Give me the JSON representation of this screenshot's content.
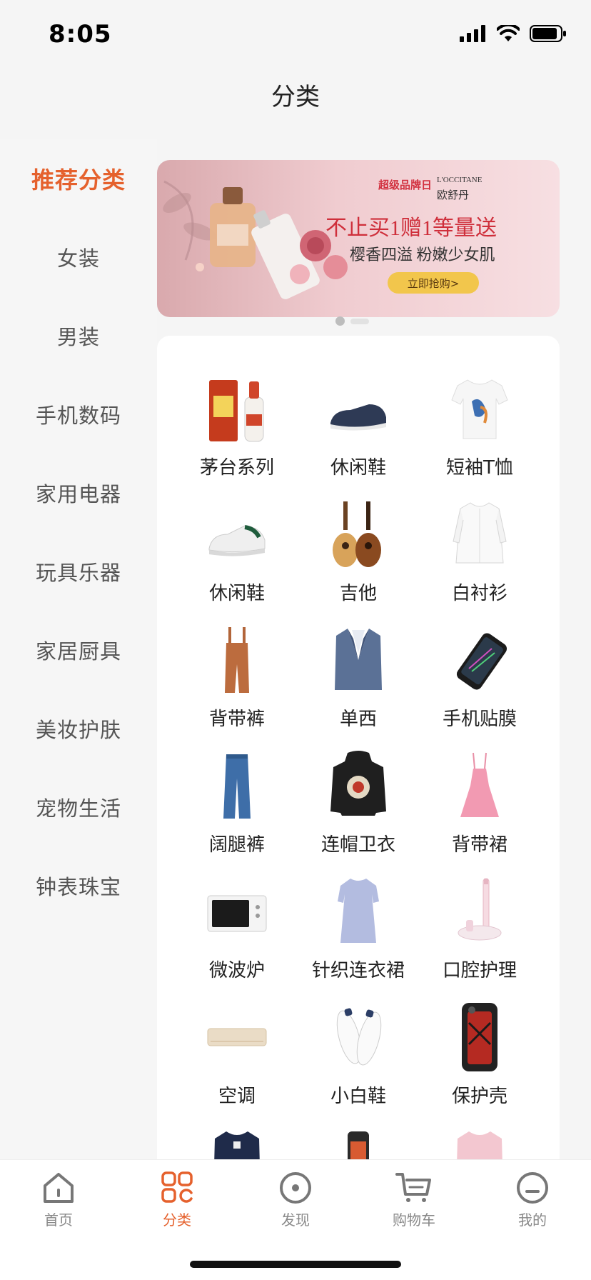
{
  "status": {
    "time": "8:05"
  },
  "header": {
    "title": "分类"
  },
  "sidebar": {
    "items": [
      {
        "label": "推荐分类"
      },
      {
        "label": "女装"
      },
      {
        "label": "男装"
      },
      {
        "label": "手机数码"
      },
      {
        "label": "家用电器"
      },
      {
        "label": "玩具乐器"
      },
      {
        "label": "家居厨具"
      },
      {
        "label": "美妆护肤"
      },
      {
        "label": "宠物生活"
      },
      {
        "label": "钟表珠宝"
      }
    ]
  },
  "banner": {
    "brand_en": "L'OCCITANE",
    "brand_cn": "欧舒丹",
    "campaign": "超级品牌日",
    "headline": "不止买1赠1等量送",
    "subline": "樱香四溢 粉嫩少女肌",
    "cta": "立即抢购>"
  },
  "grid": {
    "items": [
      {
        "label": "茅台系列",
        "icon": "liquor-icon"
      },
      {
        "label": "休闲鞋",
        "icon": "shoe-icon"
      },
      {
        "label": "短袖T恤",
        "icon": "tshirt-icon"
      },
      {
        "label": "休闲鞋",
        "icon": "sneaker-icon"
      },
      {
        "label": "吉他",
        "icon": "guitar-icon"
      },
      {
        "label": "白衬衫",
        "icon": "shirt-icon"
      },
      {
        "label": "背带裤",
        "icon": "overalls-icon"
      },
      {
        "label": "单西",
        "icon": "blazer-icon"
      },
      {
        "label": "手机贴膜",
        "icon": "screen-protector-icon"
      },
      {
        "label": "阔腿裤",
        "icon": "pants-icon"
      },
      {
        "label": "连帽卫衣",
        "icon": "hoodie-icon"
      },
      {
        "label": "背带裙",
        "icon": "dress-icon"
      },
      {
        "label": "微波炉",
        "icon": "microwave-icon"
      },
      {
        "label": "针织连衣裙",
        "icon": "knit-dress-icon"
      },
      {
        "label": "口腔护理",
        "icon": "toothbrush-icon"
      },
      {
        "label": "空调",
        "icon": "air-conditioner-icon"
      },
      {
        "label": "小白鞋",
        "icon": "white-shoe-icon"
      },
      {
        "label": "保护壳",
        "icon": "phone-case-icon"
      }
    ]
  },
  "tabs": [
    {
      "label": "首页",
      "icon": "home-icon"
    },
    {
      "label": "分类",
      "icon": "category-icon"
    },
    {
      "label": "发现",
      "icon": "discover-icon"
    },
    {
      "label": "购物车",
      "icon": "cart-icon"
    },
    {
      "label": "我的",
      "icon": "profile-icon"
    }
  ],
  "colors": {
    "accent": "#e5612d",
    "text": "#222222",
    "muted": "#888888"
  }
}
